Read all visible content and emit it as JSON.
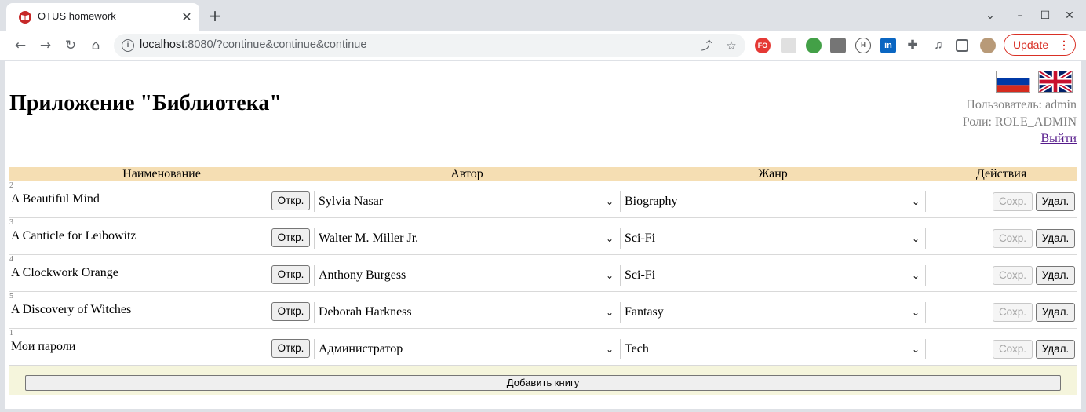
{
  "browser": {
    "tab_title": "OTUS homework",
    "url_host": "localhost",
    "url_rest": ":8080/?continue&continue&continue",
    "update_label": "Update",
    "ext_fo": "FO"
  },
  "app": {
    "title": "Приложение \"Библиотека\"",
    "user_line": "Пользователь: admin",
    "roles_line": "Роли: ROLE_ADMIN",
    "logout": "Выйти"
  },
  "table": {
    "headers": {
      "name": "Наименование",
      "author": "Автор",
      "genre": "Жанр",
      "actions": "Действия"
    },
    "open_label": "Откр.",
    "save_label": "Сохр.",
    "delete_label": "Удал.",
    "rows": [
      {
        "id": "2",
        "name": "A Beautiful Mind",
        "author": "Sylvia Nasar",
        "genre": "Biography"
      },
      {
        "id": "3",
        "name": "A Canticle for Leibowitz",
        "author": "Walter M. Miller Jr.",
        "genre": "Sci-Fi"
      },
      {
        "id": "4",
        "name": "A Clockwork Orange",
        "author": "Anthony Burgess",
        "genre": "Sci-Fi"
      },
      {
        "id": "5",
        "name": "A Discovery of Witches",
        "author": "Deborah Harkness",
        "genre": "Fantasy"
      },
      {
        "id": "1",
        "name": "Мои пароли",
        "author": "Администратор",
        "genre": "Tech"
      }
    ],
    "add_label": "Добавить книгу"
  },
  "colors": {
    "header_bg": "#f5deb3",
    "add_bar_bg": "#f5f5dc",
    "update_accent": "#d93025"
  }
}
